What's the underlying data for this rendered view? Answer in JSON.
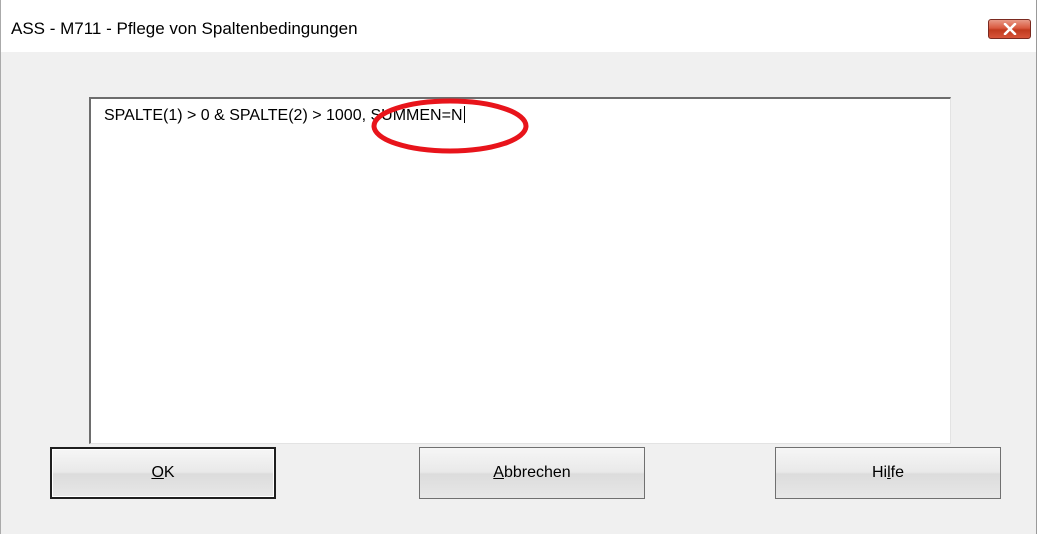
{
  "window": {
    "title": "ASS - M711 - Pflege von Spaltenbedingungen",
    "close_icon": "close-icon"
  },
  "editor": {
    "value": "SPALTE(1) > 0 & SPALTE(2) > 1000, SUMMEN=N",
    "annotation": "red-circle-highlight",
    "annotation_color": "#e8141b"
  },
  "buttons": {
    "ok": {
      "label": "OK",
      "mnemonic": "O"
    },
    "cancel": {
      "label": "Abbrechen",
      "mnemonic": "A"
    },
    "help": {
      "label": "Hilfe",
      "mnemonic": "l"
    }
  }
}
